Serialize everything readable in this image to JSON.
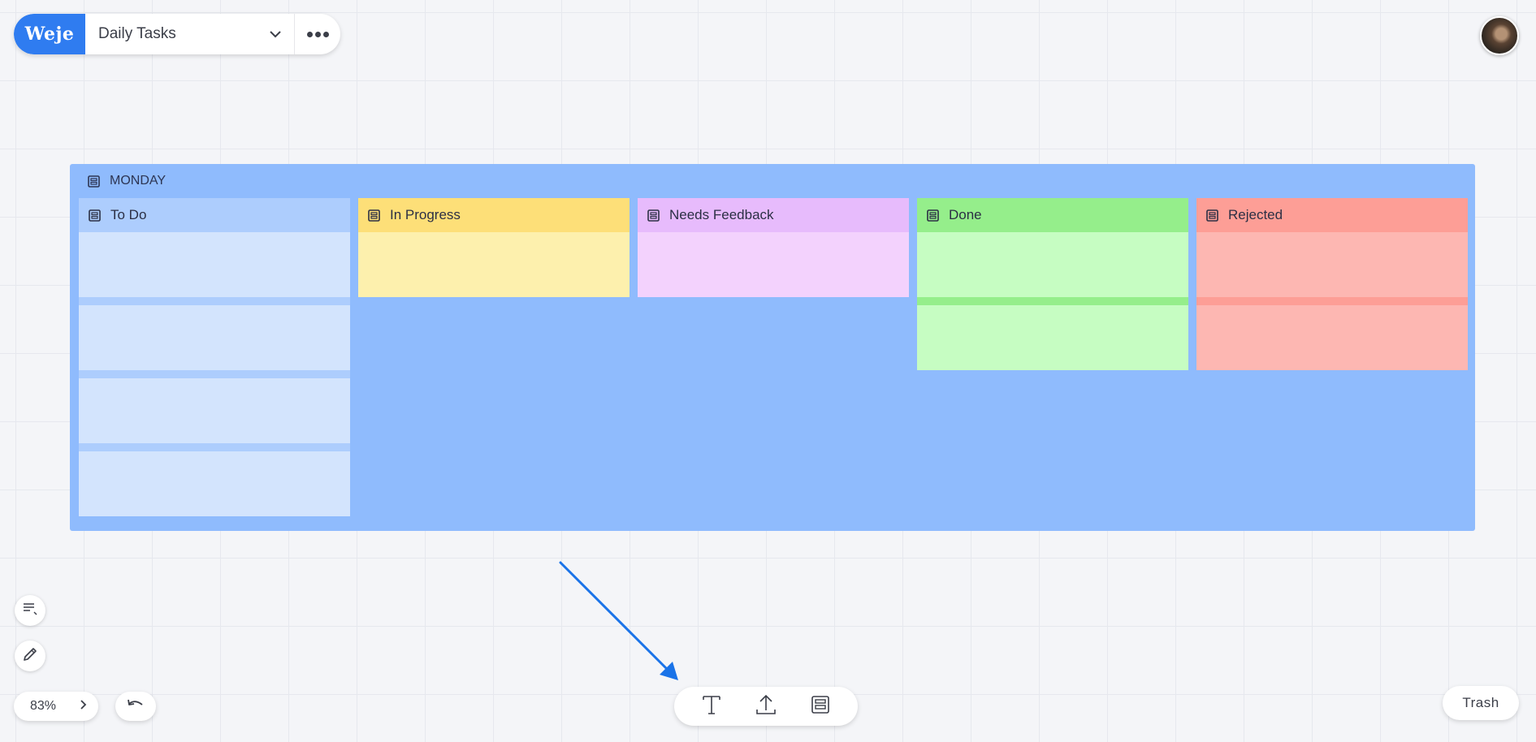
{
  "app": {
    "logo_text": "Weje",
    "board_name": "Daily Tasks"
  },
  "board": {
    "title": "MONDAY",
    "background": "#8fbbfd",
    "columns": [
      {
        "title": "To Do",
        "header_color": "#adcdfd",
        "card_color": "#d3e4fd",
        "cards": 4
      },
      {
        "title": "In Progress",
        "header_color": "#fddf78",
        "card_color": "#fdf0ad",
        "cards": 1
      },
      {
        "title": "Needs Feedback",
        "header_color": "#e7bbfc",
        "card_color": "#f3d2fd",
        "cards": 1
      },
      {
        "title": "Done",
        "header_color": "#95ee8b",
        "card_color": "#c6fdc2",
        "cards": 2
      },
      {
        "title": "Rejected",
        "header_color": "#fd9e96",
        "card_color": "#fdb7b2",
        "cards": 2
      }
    ]
  },
  "controls": {
    "zoom": "83%",
    "trash_label": "Trash"
  },
  "toolbar": {
    "tools": [
      "text-tool",
      "upload-tool",
      "frame-tool"
    ]
  },
  "colors": {
    "accent": "#2f7cf0",
    "annotation_arrow": "#1a73e8"
  }
}
